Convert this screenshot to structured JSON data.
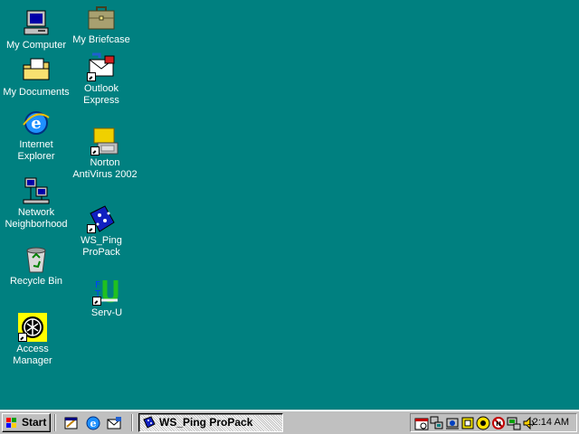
{
  "desktop": {
    "icons": [
      {
        "label": "My Computer",
        "icon": "my-computer-icon"
      },
      {
        "label": "My Documents",
        "icon": "my-documents-icon"
      },
      {
        "label": "Internet\nExplorer",
        "icon": "internet-explorer-icon"
      },
      {
        "label": "Network\nNeighborhood",
        "icon": "network-neighborhood-icon"
      },
      {
        "label": "Recycle Bin",
        "icon": "recycle-bin-icon"
      },
      {
        "label": "Access\nManager",
        "icon": "access-manager-icon"
      },
      {
        "label": "My Briefcase",
        "icon": "briefcase-icon"
      },
      {
        "label": "Outlook\nExpress",
        "icon": "outlook-express-icon"
      },
      {
        "label": "Norton\nAntiVirus 2002",
        "icon": "norton-antivirus-icon"
      },
      {
        "label": "WS_Ping\nProPack",
        "icon": "ws-ping-icon"
      },
      {
        "label": "Serv-U",
        "icon": "serv-u-icon"
      }
    ]
  },
  "taskbar": {
    "start_label": "Start",
    "quick_launch": [
      "show-desktop-icon",
      "ie-launch-icon",
      "outlook-launch-icon"
    ],
    "tasks": [
      {
        "label": "WS_Ping ProPack"
      }
    ],
    "tray_icons": [
      "scheduler-icon",
      "network-tray-icon",
      "sync-tray-icon",
      "folder-tray-icon",
      "norton-tray-icon",
      "blocked-tray-icon",
      "monitor-tray-icon",
      "speaker-tray-icon"
    ],
    "clock": "12:14 AM"
  },
  "colors": {
    "desktop": "#008080",
    "taskbar": "#c0c0c0"
  }
}
